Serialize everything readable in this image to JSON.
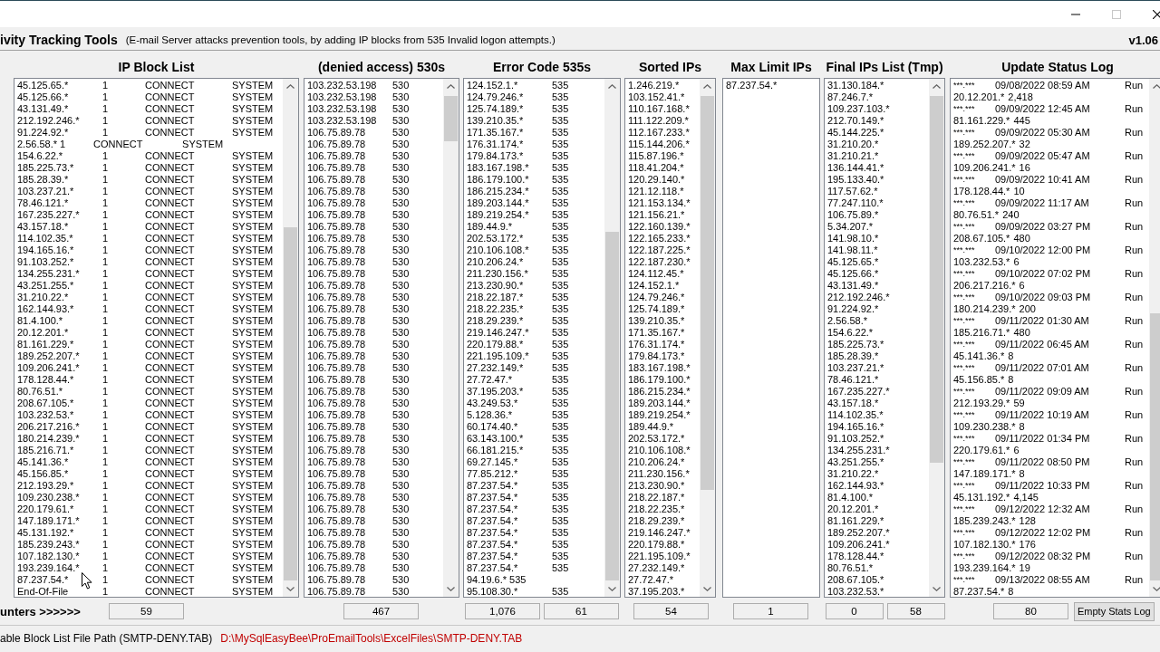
{
  "window": {
    "title": "ivity Tracking Tools",
    "subtitle": "(E-mail Server attacks prevention tools, by adding IP blocks from 535 Invalid logon attempts.)",
    "version": "v1.06",
    "maximize_disabled": true
  },
  "counters_label": "unters >>>>>>",
  "block_list": {
    "title": "IP Block List",
    "counters": [
      "59"
    ],
    "rows": [
      {
        "ip": "45.125.65.*",
        "count": "1",
        "action": "CONNECT",
        "user": "SYSTEM",
        "kind": "plain"
      },
      {
        "ip": "45.125.66.*",
        "count": "1",
        "action": "CONNECT",
        "user": "SYSTEM",
        "kind": "plain"
      },
      {
        "ip": "43.131.49.*",
        "count": "1",
        "action": "CONNECT",
        "user": "SYSTEM",
        "kind": "plain"
      },
      {
        "ip": "212.192.246.*",
        "count": "1",
        "action": "CONNECT",
        "user": "SYSTEM",
        "kind": "plain"
      },
      {
        "ip": "91.224.92.*",
        "count": "1",
        "action": "CONNECT",
        "user": "SYSTEM",
        "kind": "plain"
      },
      {
        "ip": "2.56.58.*",
        "count": "1",
        "action": "CONNECT",
        "user": "SYSTEM",
        "kind": "tabbed"
      },
      {
        "ip": "154.6.22.*",
        "count": "1",
        "action": "CONNECT",
        "user": "SYSTEM",
        "kind": "plain"
      },
      {
        "ip": "185.225.73.*",
        "count": "1",
        "action": "CONNECT",
        "user": "SYSTEM",
        "kind": "plain"
      },
      {
        "ip": "185.28.39.*",
        "count": "1",
        "action": "CONNECT",
        "user": "SYSTEM",
        "kind": "plain"
      },
      {
        "ip": "103.237.21.*",
        "count": "1",
        "action": "CONNECT",
        "user": "SYSTEM",
        "kind": "plain"
      },
      {
        "ip": "78.46.121.*",
        "count": "1",
        "action": "CONNECT",
        "user": "SYSTEM",
        "kind": "plain"
      },
      {
        "ip": "167.235.227.*",
        "count": "1",
        "action": "CONNECT",
        "user": "SYSTEM",
        "kind": "plain"
      },
      {
        "ip": "43.157.18.*",
        "count": "1",
        "action": "CONNECT",
        "user": "SYSTEM",
        "kind": "plain"
      },
      {
        "ip": "114.102.35.*",
        "count": "1",
        "action": "CONNECT",
        "user": "SYSTEM",
        "kind": "plain"
      },
      {
        "ip": "194.165.16.*",
        "count": "1",
        "action": "CONNECT",
        "user": "SYSTEM",
        "kind": "plain"
      },
      {
        "ip": "91.103.252.*",
        "count": "1",
        "action": "CONNECT",
        "user": "SYSTEM",
        "kind": "plain"
      },
      {
        "ip": "134.255.231.*",
        "count": "1",
        "action": "CONNECT",
        "user": "SYSTEM",
        "kind": "plain"
      },
      {
        "ip": "43.251.255.*",
        "count": "1",
        "action": "CONNECT",
        "user": "SYSTEM",
        "kind": "plain"
      },
      {
        "ip": "31.210.22.*",
        "count": "1",
        "action": "CONNECT",
        "user": "SYSTEM",
        "kind": "plain"
      },
      {
        "ip": "162.144.93.*",
        "count": "1",
        "action": "CONNECT",
        "user": "SYSTEM",
        "kind": "plain"
      },
      {
        "ip": "81.4.100.*",
        "count": "1",
        "action": "CONNECT",
        "user": "SYSTEM",
        "kind": "plain"
      },
      {
        "ip": "20.12.201.*",
        "count": "1",
        "action": "CONNECT",
        "user": "SYSTEM",
        "kind": "plain"
      },
      {
        "ip": "81.161.229.*",
        "count": "1",
        "action": "CONNECT",
        "user": "SYSTEM",
        "kind": "plain"
      },
      {
        "ip": "189.252.207.*",
        "count": "1",
        "action": "CONNECT",
        "user": "SYSTEM",
        "kind": "plain"
      },
      {
        "ip": "109.206.241.*",
        "count": "1",
        "action": "CONNECT",
        "user": "SYSTEM",
        "kind": "plain"
      },
      {
        "ip": "178.128.44.*",
        "count": "1",
        "action": "CONNECT",
        "user": "SYSTEM",
        "kind": "plain"
      },
      {
        "ip": "80.76.51.*",
        "count": "1",
        "action": "CONNECT",
        "user": "SYSTEM",
        "kind": "plain"
      },
      {
        "ip": "208.67.105.*",
        "count": "1",
        "action": "CONNECT",
        "user": "SYSTEM",
        "kind": "plain"
      },
      {
        "ip": "103.232.53.*",
        "count": "1",
        "action": "CONNECT",
        "user": "SYSTEM",
        "kind": "plain"
      },
      {
        "ip": "206.217.216.*",
        "count": "1",
        "action": "CONNECT",
        "user": "SYSTEM",
        "kind": "plain"
      },
      {
        "ip": "180.214.239.*",
        "count": "1",
        "action": "CONNECT",
        "user": "SYSTEM",
        "kind": "plain"
      },
      {
        "ip": "185.216.71.*",
        "count": "1",
        "action": "CONNECT",
        "user": "SYSTEM",
        "kind": "plain"
      },
      {
        "ip": "45.141.36.*",
        "count": "1",
        "action": "CONNECT",
        "user": "SYSTEM",
        "kind": "plain"
      },
      {
        "ip": "45.156.85.*",
        "count": "1",
        "action": "CONNECT",
        "user": "SYSTEM",
        "kind": "plain"
      },
      {
        "ip": "212.193.29.*",
        "count": "1",
        "action": "CONNECT",
        "user": "SYSTEM",
        "kind": "plain"
      },
      {
        "ip": "109.230.238.*",
        "count": "1",
        "action": "CONNECT",
        "user": "SYSTEM",
        "kind": "plain"
      },
      {
        "ip": "220.179.61.*",
        "count": "1",
        "action": "CONNECT",
        "user": "SYSTEM",
        "kind": "plain"
      },
      {
        "ip": "147.189.171.*",
        "count": "1",
        "action": "CONNECT",
        "user": "SYSTEM",
        "kind": "plain"
      },
      {
        "ip": "45.131.192.*",
        "count": "1",
        "action": "CONNECT",
        "user": "SYSTEM",
        "kind": "plain"
      },
      {
        "ip": "185.239.243.*",
        "count": "1",
        "action": "CONNECT",
        "user": "SYSTEM",
        "kind": "plain"
      },
      {
        "ip": "107.182.130.*",
        "count": "1",
        "action": "CONNECT",
        "user": "SYSTEM",
        "kind": "plain"
      },
      {
        "ip": "193.239.164.*",
        "count": "1",
        "action": "CONNECT",
        "user": "SYSTEM",
        "kind": "plain"
      },
      {
        "ip": "87.237.54.*",
        "count": "1",
        "action": "CONNECT",
        "user": "SYSTEM",
        "kind": "plain"
      },
      {
        "ip": "End-Of-File",
        "count": "1",
        "action": "CONNECT",
        "user": "SYSTEM",
        "kind": "plain"
      }
    ]
  },
  "denied_530": {
    "title": "(denied access) 530s",
    "counters": [
      "467"
    ],
    "rows": [
      {
        "ip": "103.232.53.198",
        "code": "530"
      },
      {
        "ip": "103.232.53.198",
        "code": "530"
      },
      {
        "ip": "103.232.53.198",
        "code": "530"
      },
      {
        "ip": "103.232.53.198",
        "code": "530"
      },
      {
        "ip": "106.75.89.78",
        "code": "530"
      },
      {
        "ip": "106.75.89.78",
        "code": "530"
      },
      {
        "ip": "106.75.89.78",
        "code": "530"
      },
      {
        "ip": "106.75.89.78",
        "code": "530"
      },
      {
        "ip": "106.75.89.78",
        "code": "530"
      },
      {
        "ip": "106.75.89.78",
        "code": "530"
      },
      {
        "ip": "106.75.89.78",
        "code": "530"
      },
      {
        "ip": "106.75.89.78",
        "code": "530"
      },
      {
        "ip": "106.75.89.78",
        "code": "530"
      },
      {
        "ip": "106.75.89.78",
        "code": "530"
      },
      {
        "ip": "106.75.89.78",
        "code": "530"
      },
      {
        "ip": "106.75.89.78",
        "code": "530"
      },
      {
        "ip": "106.75.89.78",
        "code": "530"
      },
      {
        "ip": "106.75.89.78",
        "code": "530"
      },
      {
        "ip": "106.75.89.78",
        "code": "530"
      },
      {
        "ip": "106.75.89.78",
        "code": "530"
      },
      {
        "ip": "106.75.89.78",
        "code": "530"
      },
      {
        "ip": "106.75.89.78",
        "code": "530"
      },
      {
        "ip": "106.75.89.78",
        "code": "530"
      },
      {
        "ip": "106.75.89.78",
        "code": "530"
      },
      {
        "ip": "106.75.89.78",
        "code": "530"
      },
      {
        "ip": "106.75.89.78",
        "code": "530"
      },
      {
        "ip": "106.75.89.78",
        "code": "530"
      },
      {
        "ip": "106.75.89.78",
        "code": "530"
      },
      {
        "ip": "106.75.89.78",
        "code": "530"
      },
      {
        "ip": "106.75.89.78",
        "code": "530"
      },
      {
        "ip": "106.75.89.78",
        "code": "530"
      },
      {
        "ip": "106.75.89.78",
        "code": "530"
      },
      {
        "ip": "106.75.89.78",
        "code": "530"
      },
      {
        "ip": "106.75.89.78",
        "code": "530"
      },
      {
        "ip": "106.75.89.78",
        "code": "530"
      },
      {
        "ip": "106.75.89.78",
        "code": "530"
      },
      {
        "ip": "106.75.89.78",
        "code": "530"
      },
      {
        "ip": "106.75.89.78",
        "code": "530"
      },
      {
        "ip": "106.75.89.78",
        "code": "530"
      },
      {
        "ip": "106.75.89.78",
        "code": "530"
      },
      {
        "ip": "106.75.89.78",
        "code": "530"
      },
      {
        "ip": "106.75.89.78",
        "code": "530"
      },
      {
        "ip": "106.75.89.78",
        "code": "530"
      },
      {
        "ip": "106.75.89.78",
        "code": "530"
      }
    ]
  },
  "error_535": {
    "title": "Error Code 535s",
    "counters": [
      "1,076",
      "61"
    ],
    "rows": [
      {
        "ip": "124.152.1.*",
        "code": "535",
        "kind": "plain"
      },
      {
        "ip": "124.79.246.*",
        "code": "535",
        "kind": "plain"
      },
      {
        "ip": "125.74.189.*",
        "code": "535",
        "kind": "plain"
      },
      {
        "ip": "139.210.35.*",
        "code": "535",
        "kind": "plain"
      },
      {
        "ip": "171.35.167.*",
        "code": "535",
        "kind": "plain"
      },
      {
        "ip": "176.31.174.*",
        "code": "535",
        "kind": "plain"
      },
      {
        "ip": "179.84.173.*",
        "code": "535",
        "kind": "plain"
      },
      {
        "ip": "183.167.198.*",
        "code": "535",
        "kind": "plain"
      },
      {
        "ip": "186.179.100.*",
        "code": "535",
        "kind": "plain"
      },
      {
        "ip": "186.215.234.*",
        "code": "535",
        "kind": "plain"
      },
      {
        "ip": "189.203.144.*",
        "code": "535",
        "kind": "plain"
      },
      {
        "ip": "189.219.254.*",
        "code": "535",
        "kind": "plain"
      },
      {
        "ip": "189.44.9.*",
        "code": "535",
        "kind": "plain"
      },
      {
        "ip": "202.53.172.*",
        "code": "535",
        "kind": "plain"
      },
      {
        "ip": "210.106.108.*",
        "code": "535",
        "kind": "plain"
      },
      {
        "ip": "210.206.24.*",
        "code": "535",
        "kind": "plain"
      },
      {
        "ip": "211.230.156.*",
        "code": "535",
        "kind": "plain"
      },
      {
        "ip": "213.230.90.*",
        "code": "535",
        "kind": "plain"
      },
      {
        "ip": "218.22.187.*",
        "code": "535",
        "kind": "plain"
      },
      {
        "ip": "218.22.235.*",
        "code": "535",
        "kind": "plain"
      },
      {
        "ip": "218.29.239.*",
        "code": "535",
        "kind": "plain"
      },
      {
        "ip": "219.146.247.*",
        "code": "535",
        "kind": "plain"
      },
      {
        "ip": "220.179.88.*",
        "code": "535",
        "kind": "plain"
      },
      {
        "ip": "221.195.109.*",
        "code": "535",
        "kind": "plain"
      },
      {
        "ip": "27.232.149.*",
        "code": "535",
        "kind": "plain"
      },
      {
        "ip": "27.72.47.*",
        "code": "535",
        "kind": "plain"
      },
      {
        "ip": "37.195.203.*",
        "code": "535",
        "kind": "plain"
      },
      {
        "ip": "43.249.53.*",
        "code": "535",
        "kind": "plain"
      },
      {
        "ip": "5.128.36.*",
        "code": "535",
        "kind": "plain"
      },
      {
        "ip": "60.174.40.*",
        "code": "535",
        "kind": "plain"
      },
      {
        "ip": "63.143.100.*",
        "code": "535",
        "kind": "plain"
      },
      {
        "ip": "66.181.215.*",
        "code": "535",
        "kind": "plain"
      },
      {
        "ip": "69.27.145.*",
        "code": "535",
        "kind": "plain"
      },
      {
        "ip": "77.85.212.*",
        "code": "535",
        "kind": "plain"
      },
      {
        "ip": "87.237.54.*",
        "code": "535",
        "kind": "plain"
      },
      {
        "ip": "87.237.54.*",
        "code": "535",
        "kind": "plain"
      },
      {
        "ip": "87.237.54.*",
        "code": "535",
        "kind": "plain"
      },
      {
        "ip": "87.237.54.*",
        "code": "535",
        "kind": "plain"
      },
      {
        "ip": "87.237.54.*",
        "code": "535",
        "kind": "plain"
      },
      {
        "ip": "87.237.54.*",
        "code": "535",
        "kind": "plain"
      },
      {
        "ip": "87.237.54.*",
        "code": "535",
        "kind": "plain"
      },
      {
        "ip": "87.237.54.*",
        "code": "535",
        "kind": "plain"
      },
      {
        "ip": "94.19.6.*",
        "code": "535",
        "kind": "tabbed"
      },
      {
        "ip": "95.108.30.*",
        "code": "535",
        "kind": "plain"
      }
    ]
  },
  "sorted_ips": {
    "title": "Sorted IPs",
    "counters": [
      "54"
    ],
    "items": [
      "1.246.219.*",
      "103.152.41.*",
      "110.167.168.*",
      "111.122.209.*",
      "112.167.233.*",
      "115.144.206.*",
      "115.87.196.*",
      "118.41.204.*",
      "120.29.140.*",
      "121.12.118.*",
      "121.153.134.*",
      "121.156.21.*",
      "122.160.139.*",
      "122.165.233.*",
      "122.187.225.*",
      "122.187.230.*",
      "124.112.45.*",
      "124.152.1.*",
      "124.79.246.*",
      "125.74.189.*",
      "139.210.35.*",
      "171.35.167.*",
      "176.31.174.*",
      "179.84.173.*",
      "183.167.198.*",
      "186.179.100.*",
      "186.215.234.*",
      "189.203.144.*",
      "189.219.254.*",
      "189.44.9.*",
      "202.53.172.*",
      "210.106.108.*",
      "210.206.24.*",
      "211.230.156.*",
      "213.230.90.*",
      "218.22.187.*",
      "218.22.235.*",
      "218.29.239.*",
      "219.146.247.*",
      "220.179.88.*",
      "221.195.109.*",
      "27.232.149.*",
      "27.72.47.*",
      "37.195.203.*"
    ]
  },
  "max_limit_ips": {
    "title": "Max Limit IPs",
    "counters": [
      "1"
    ],
    "items": [
      "87.237.54.*"
    ]
  },
  "final_ips": {
    "title": "Final IPs List (Tmp)",
    "counters": [
      "0",
      "58"
    ],
    "items": [
      "31.130.184.*",
      "87.246.7.*",
      "109.237.103.*",
      "212.70.149.*",
      "45.144.225.*",
      "31.210.20.*",
      "31.210.21.*",
      "136.144.41.*",
      "195.133.40.*",
      "117.57.62.*",
      "77.247.110.*",
      "106.75.89.*",
      "5.34.207.*",
      "141.98.10.*",
      "141.98.11.*",
      "45.125.65.*",
      "45.125.66.*",
      "43.131.49.*",
      "212.192.246.*",
      "91.224.92.*",
      "2.56.58.*",
      "154.6.22.*",
      "185.225.73.*",
      "185.28.39.*",
      "103.237.21.*",
      "78.46.121.*",
      "167.235.227.*",
      "43.157.18.*",
      "114.102.35.*",
      "194.165.16.*",
      "91.103.252.*",
      "134.255.231.*",
      "43.251.255.*",
      "31.210.22.*",
      "162.144.93.*",
      "81.4.100.*",
      "20.12.201.*",
      "81.161.229.*",
      "189.252.207.*",
      "109.206.241.*",
      "178.128.44.*",
      "80.76.51.*",
      "208.67.105.*",
      "103.232.53.*"
    ]
  },
  "status_log": {
    "title": "Update Status Log",
    "counters": [
      "80"
    ],
    "button": "Empty Stats Log",
    "entries": [
      {
        "mask": "***.***",
        "date": "09/08/2022 08:59 AM",
        "action": "Run",
        "ip": "20.12.201.*",
        "count": "2,418"
      },
      {
        "mask": "***.***",
        "date": "09/09/2022 12:45 AM",
        "action": "Run",
        "ip": "81.161.229.*",
        "count": "445"
      },
      {
        "mask": "***.***",
        "date": "09/09/2022 05:30 AM",
        "action": "Run",
        "ip": "189.252.207.*",
        "count": "32"
      },
      {
        "mask": "***.***",
        "date": "09/09/2022 05:47 AM",
        "action": "Run",
        "ip": "109.206.241.*",
        "count": "16"
      },
      {
        "mask": "***.***",
        "date": "09/09/2022 10:41 AM",
        "action": "Run",
        "ip": "178.128.44.*",
        "count": "10"
      },
      {
        "mask": "***.***",
        "date": "09/09/2022 11:17 AM",
        "action": "Run",
        "ip": "80.76.51.*",
        "count": "240"
      },
      {
        "mask": "***.***",
        "date": "09/09/2022 03:27 PM",
        "action": "Run",
        "ip": "208.67.105.*",
        "count": "480"
      },
      {
        "mask": "***.***",
        "date": "09/10/2022 12:00 PM",
        "action": "Run",
        "ip": "103.232.53.*",
        "count": "6"
      },
      {
        "mask": "***.***",
        "date": "09/10/2022 07:02 PM",
        "action": "Run",
        "ip": "206.217.216.*",
        "count": "6"
      },
      {
        "mask": "***.***",
        "date": "09/10/2022 09:03 PM",
        "action": "Run",
        "ip": "180.214.239.*",
        "count": "200"
      },
      {
        "mask": "***.***",
        "date": "09/11/2022 01:30 AM",
        "action": "Run",
        "ip": "185.216.71.*",
        "count": "480"
      },
      {
        "mask": "***.***",
        "date": "09/11/2022 06:45 AM",
        "action": "Run",
        "ip": "45.141.36.*",
        "count": "8"
      },
      {
        "mask": "***.***",
        "date": "09/11/2022 07:01 AM",
        "action": "Run",
        "ip": "45.156.85.*",
        "count": "8"
      },
      {
        "mask": "***.***",
        "date": "09/11/2022 09:09 AM",
        "action": "Run",
        "ip": "212.193.29.*",
        "count": "59"
      },
      {
        "mask": "***.***",
        "date": "09/11/2022 10:19 AM",
        "action": "Run",
        "ip": "109.230.238.*",
        "count": "8"
      },
      {
        "mask": "***.***",
        "date": "09/11/2022 01:34 PM",
        "action": "Run",
        "ip": "220.179.61.*",
        "count": "6"
      },
      {
        "mask": "***.***",
        "date": "09/11/2022 08:50 PM",
        "action": "Run",
        "ip": "147.189.171.*",
        "count": "8"
      },
      {
        "mask": "***.***",
        "date": "09/11/2022 10:33 PM",
        "action": "Run",
        "ip": "45.131.192.*",
        "count": "4,145"
      },
      {
        "mask": "***.***",
        "date": "09/12/2022 12:32 AM",
        "action": "Run",
        "ip": "185.239.243.*",
        "count": "128"
      },
      {
        "mask": "***.***",
        "date": "09/12/2022 12:02 PM",
        "action": "Run",
        "ip": "107.182.130.*",
        "count": "176"
      },
      {
        "mask": "***.***",
        "date": "09/12/2022 08:32 PM",
        "action": "Run",
        "ip": "193.239.164.*",
        "count": "19"
      },
      {
        "mask": "***.***",
        "date": "09/13/2022 08:55 AM",
        "action": "Run",
        "ip": "87.237.54.*",
        "count": "8"
      }
    ]
  },
  "file_path": {
    "label": "able Block List File Path (SMTP-DENY.TAB)",
    "value": "D:\\MySqlEasyBee\\ProEmailTools\\ExcelFiles\\SMTP-DENY.TAB"
  }
}
